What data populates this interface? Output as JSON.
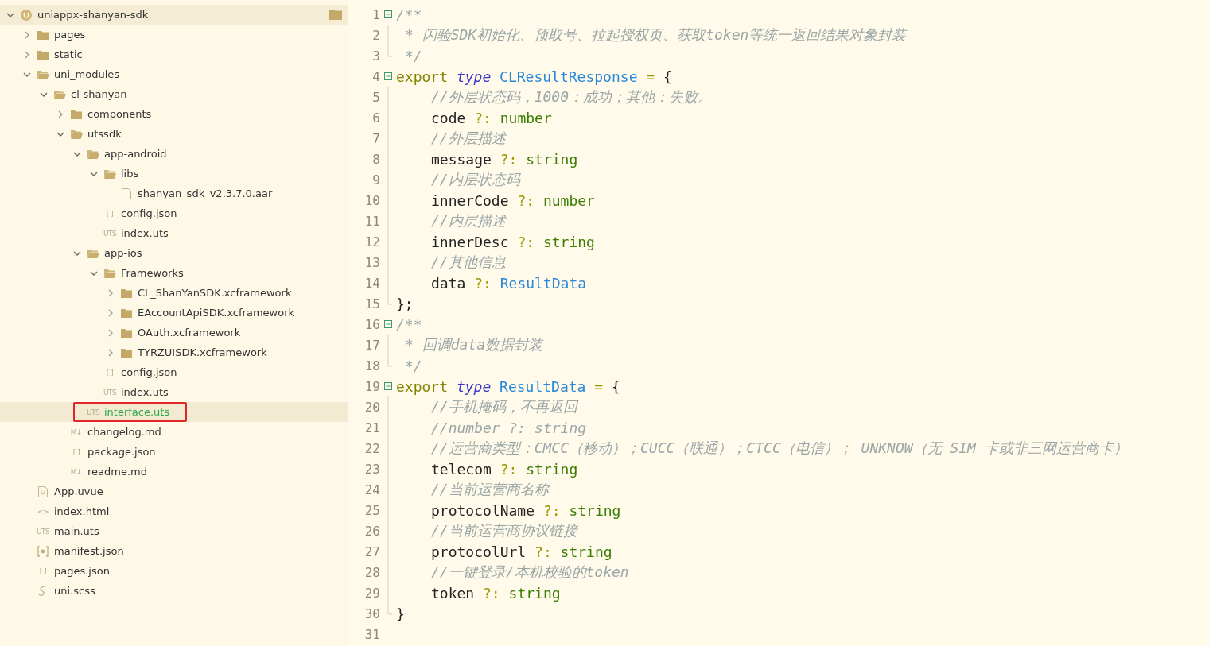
{
  "sidebar": {
    "tree": [
      {
        "label": "uniappx-shanyan-sdk",
        "kind": "project",
        "expanded": true,
        "selected": false,
        "children": [
          {
            "label": "pages",
            "kind": "folder",
            "expanded": false,
            "selected": false
          },
          {
            "label": "static",
            "kind": "folder",
            "expanded": false,
            "selected": false
          },
          {
            "label": "uni_modules",
            "kind": "folder",
            "expanded": true,
            "selected": false,
            "children": [
              {
                "label": "cl-shanyan",
                "kind": "folder",
                "expanded": true,
                "selected": false,
                "children": [
                  {
                    "label": "components",
                    "kind": "folder",
                    "expanded": false,
                    "selected": false
                  },
                  {
                    "label": "utssdk",
                    "kind": "folder",
                    "expanded": true,
                    "selected": false,
                    "children": [
                      {
                        "label": "app-android",
                        "kind": "folder",
                        "expanded": true,
                        "selected": false,
                        "children": [
                          {
                            "label": "libs",
                            "kind": "folder",
                            "expanded": true,
                            "selected": false,
                            "children": [
                              {
                                "label": "shanyan_sdk_v2.3.7.0.aar",
                                "kind": "file",
                                "selected": false
                              }
                            ]
                          },
                          {
                            "label": "config.json",
                            "kind": "glyph",
                            "glyph": "[ ]",
                            "selected": false
                          },
                          {
                            "label": "index.uts",
                            "kind": "glyph",
                            "glyph": "UTS",
                            "selected": false
                          }
                        ]
                      },
                      {
                        "label": "app-ios",
                        "kind": "folder",
                        "expanded": true,
                        "selected": false,
                        "children": [
                          {
                            "label": "Frameworks",
                            "kind": "folder",
                            "expanded": true,
                            "selected": false,
                            "children": [
                              {
                                "label": "CL_ShanYanSDK.xcframework",
                                "kind": "folder",
                                "expanded": false,
                                "selected": false
                              },
                              {
                                "label": "EAccountApiSDK.xcframework",
                                "kind": "folder",
                                "expanded": false,
                                "selected": false
                              },
                              {
                                "label": "OAuth.xcframework",
                                "kind": "folder",
                                "expanded": false,
                                "selected": false
                              },
                              {
                                "label": "TYRZUISDK.xcframework",
                                "kind": "folder",
                                "expanded": false,
                                "selected": false
                              }
                            ]
                          },
                          {
                            "label": "config.json",
                            "kind": "glyph",
                            "glyph": "[ ]",
                            "selected": false
                          },
                          {
                            "label": "index.uts",
                            "kind": "glyph",
                            "glyph": "UTS",
                            "selected": false
                          }
                        ]
                      },
                      {
                        "label": "interface.uts",
                        "kind": "glyph",
                        "glyph": "UTS",
                        "selected": true
                      }
                    ]
                  },
                  {
                    "label": "changelog.md",
                    "kind": "glyph",
                    "glyph": "M↓",
                    "selected": false
                  },
                  {
                    "label": "package.json",
                    "kind": "glyph",
                    "glyph": "[ ]",
                    "selected": false
                  },
                  {
                    "label": "readme.md",
                    "kind": "glyph",
                    "glyph": "M↓",
                    "selected": false
                  }
                ]
              }
            ]
          },
          {
            "label": "App.uvue",
            "kind": "uvue",
            "selected": false
          },
          {
            "label": "index.html",
            "kind": "glyph",
            "glyph": "<>",
            "selected": false
          },
          {
            "label": "main.uts",
            "kind": "glyph",
            "glyph": "UTS",
            "selected": false
          },
          {
            "label": "manifest.json",
            "kind": "manifest",
            "selected": false
          },
          {
            "label": "pages.json",
            "kind": "glyph",
            "glyph": "[ ]",
            "selected": false
          },
          {
            "label": "uni.scss",
            "kind": "scss",
            "selected": false
          }
        ]
      }
    ]
  },
  "editor": {
    "lines": [
      {
        "number": "1",
        "kind": "open",
        "tokens": [
          {
            "kind": "comment",
            "text": "/**"
          }
        ]
      },
      {
        "number": "2",
        "kind": "doc",
        "tokens": [
          {
            "kind": "comment",
            "text": "* 闪验SDK初始化、预取号、拉起授权页、获取token等统一返回结果对象封装"
          }
        ]
      },
      {
        "number": "3",
        "kind": "docend",
        "tokens": [
          {
            "kind": "comment",
            "text": "*/"
          }
        ]
      },
      {
        "number": "4",
        "kind": "open",
        "tokens": [
          {
            "kind": "keyword",
            "text": "export"
          },
          {
            "kind": "type",
            "text": "type"
          },
          {
            "kind": "name",
            "text": "CLResultResponse"
          },
          {
            "kind": "op",
            "text": "="
          },
          {
            "kind": "punct",
            "text": "{"
          }
        ]
      },
      {
        "number": "5",
        "kind": "body",
        "tokens": [
          {
            "kind": "comment",
            "text": "//外层状态码，1000：成功；其他：失败。"
          }
        ]
      },
      {
        "number": "6",
        "kind": "body",
        "tokens": [
          {
            "kind": "prop",
            "text": "code"
          },
          {
            "kind": "op",
            "text": "?:"
          },
          {
            "kind": "prim",
            "text": "number"
          }
        ]
      },
      {
        "number": "7",
        "kind": "body",
        "tokens": [
          {
            "kind": "comment",
            "text": "//外层描述"
          }
        ]
      },
      {
        "number": "8",
        "kind": "body",
        "tokens": [
          {
            "kind": "prop",
            "text": "message"
          },
          {
            "kind": "op",
            "text": "?:"
          },
          {
            "kind": "prim",
            "text": "string"
          }
        ]
      },
      {
        "number": "9",
        "kind": "body",
        "tokens": [
          {
            "kind": "comment",
            "text": "//内层状态码"
          }
        ]
      },
      {
        "number": "10",
        "kind": "body",
        "tokens": [
          {
            "kind": "prop",
            "text": "innerCode"
          },
          {
            "kind": "op",
            "text": "?:"
          },
          {
            "kind": "prim",
            "text": "number"
          }
        ]
      },
      {
        "number": "11",
        "kind": "body",
        "tokens": [
          {
            "kind": "comment",
            "text": "//内层描述"
          }
        ]
      },
      {
        "number": "12",
        "kind": "body",
        "tokens": [
          {
            "kind": "prop",
            "text": "innerDesc"
          },
          {
            "kind": "op",
            "text": "?:"
          },
          {
            "kind": "prim",
            "text": "string"
          }
        ]
      },
      {
        "number": "13",
        "kind": "body",
        "tokens": [
          {
            "kind": "comment",
            "text": "//其他信息"
          }
        ]
      },
      {
        "number": "14",
        "kind": "body",
        "tokens": [
          {
            "kind": "prop",
            "text": "data"
          },
          {
            "kind": "op",
            "text": "?:"
          },
          {
            "kind": "name",
            "text": "ResultData"
          }
        ]
      },
      {
        "number": "15",
        "kind": "close",
        "tokens": [
          {
            "kind": "punct",
            "text": "};"
          }
        ]
      },
      {
        "number": "16",
        "kind": "open",
        "tokens": [
          {
            "kind": "comment",
            "text": "/**"
          }
        ]
      },
      {
        "number": "17",
        "kind": "doc",
        "tokens": [
          {
            "kind": "comment",
            "text": "* 回调data数据封装"
          }
        ]
      },
      {
        "number": "18",
        "kind": "docend",
        "tokens": [
          {
            "kind": "comment",
            "text": "*/"
          }
        ]
      },
      {
        "number": "19",
        "kind": "open",
        "tokens": [
          {
            "kind": "keyword",
            "text": "export"
          },
          {
            "kind": "type",
            "text": "type"
          },
          {
            "kind": "name",
            "text": "ResultData"
          },
          {
            "kind": "op",
            "text": "="
          },
          {
            "kind": "punct",
            "text": "{"
          }
        ]
      },
      {
        "number": "20",
        "kind": "body",
        "tokens": [
          {
            "kind": "comment",
            "text": "//手机掩码，不再返回"
          }
        ]
      },
      {
        "number": "21",
        "kind": "body",
        "tokens": [
          {
            "kind": "comment",
            "text": "//number ?: string"
          }
        ]
      },
      {
        "number": "22",
        "kind": "body",
        "tokens": [
          {
            "kind": "comment",
            "text": "//运营商类型：CMCC（移动）；CUCC（联通）；CTCC（电信）； UNKNOW（无 SIM 卡或非三网运营商卡）"
          }
        ]
      },
      {
        "number": "23",
        "kind": "body",
        "tokens": [
          {
            "kind": "prop",
            "text": "telecom"
          },
          {
            "kind": "op",
            "text": "?:"
          },
          {
            "kind": "prim",
            "text": "string"
          }
        ]
      },
      {
        "number": "24",
        "kind": "body",
        "tokens": [
          {
            "kind": "comment",
            "text": "//当前运营商名称"
          }
        ]
      },
      {
        "number": "25",
        "kind": "body",
        "tokens": [
          {
            "kind": "prop",
            "text": "protocolName"
          },
          {
            "kind": "op",
            "text": "?:"
          },
          {
            "kind": "prim",
            "text": "string"
          }
        ]
      },
      {
        "number": "26",
        "kind": "body",
        "tokens": [
          {
            "kind": "comment",
            "text": "//当前运营商协议链接"
          }
        ]
      },
      {
        "number": "27",
        "kind": "body",
        "tokens": [
          {
            "kind": "prop",
            "text": "protocolUrl"
          },
          {
            "kind": "op",
            "text": "?:"
          },
          {
            "kind": "prim",
            "text": "string"
          }
        ]
      },
      {
        "number": "28",
        "kind": "body",
        "tokens": [
          {
            "kind": "comment",
            "text": "//一键登录/本机校验的token"
          }
        ]
      },
      {
        "number": "29",
        "kind": "body",
        "tokens": [
          {
            "kind": "prop",
            "text": "token"
          },
          {
            "kind": "op",
            "text": "?:"
          },
          {
            "kind": "prim",
            "text": "string"
          }
        ]
      },
      {
        "number": "30",
        "kind": "close",
        "tokens": [
          {
            "kind": "punct",
            "text": "}"
          }
        ]
      },
      {
        "number": "31",
        "kind": "blank"
      }
    ]
  }
}
